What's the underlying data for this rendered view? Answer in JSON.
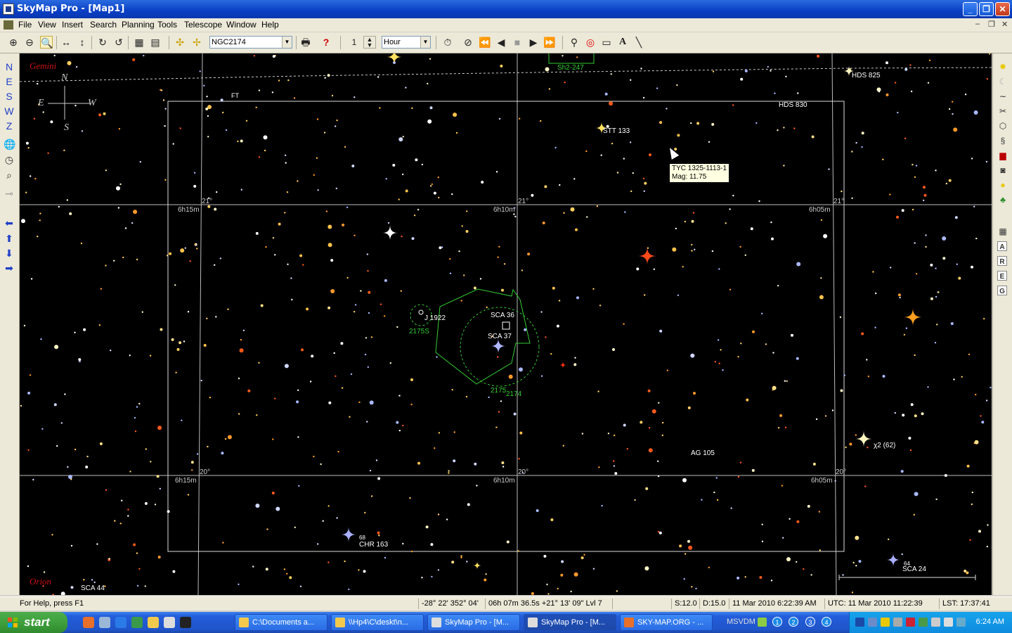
{
  "window": {
    "title": "SkyMap Pro - [Map1]",
    "buttons": {
      "minimize": "_",
      "restore": "❐",
      "close": "✕"
    }
  },
  "menu": {
    "items": [
      "File",
      "View",
      "Insert",
      "Search",
      "Planning",
      "Tools",
      "Telescope",
      "Window",
      "Help"
    ]
  },
  "toolbar": {
    "object_select": "NGC2174",
    "step_value": "1",
    "step_unit": "Hour"
  },
  "leftbar": {
    "direction_buttons": [
      "N",
      "E",
      "S",
      "W",
      "Z"
    ]
  },
  "rightbar": {
    "letter_buttons": [
      "A",
      "R",
      "E",
      "G"
    ]
  },
  "map": {
    "constellation_labels": [
      "Gemini",
      "Orion"
    ],
    "compass": {
      "n": "N",
      "e": "E",
      "s": "S",
      "w": "W"
    },
    "objects": {
      "sh2": "Sh2-247",
      "hds825": "HDS 825",
      "hds830": "HDS 830",
      "stt133": "STT 133",
      "ft": "FT",
      "j1922": "J 1922",
      "n2175s": "2175S",
      "sca36": "SCA 36",
      "sca37": "SCA 37",
      "n2175": "2175",
      "n2174": "2174",
      "ag105": "AG 105",
      "chi2": "χ2 (62)",
      "n68": "68",
      "chr163": "CHR 163",
      "sca44": "SCA 44",
      "n64": "64",
      "sca24": "SCA 24"
    },
    "grid_labels": {
      "ra_top_left": "6h15m",
      "dec_21_left": "21°",
      "ra_top_mid": "6h10m",
      "dec_21_mid": "21°",
      "ra_top_right": "6h05m",
      "dec_21_right": "21°",
      "ra_bot_left": "6h15m",
      "dec_20_left": "20°",
      "ra_bot_mid": "6h10m",
      "dec_20_mid": "20°",
      "ra_bot_right": "6h05m",
      "dec_20_right": "20°"
    },
    "tooltip": {
      "line1": "TYC 1325-1113-1",
      "line2": "Mag: 11.75"
    }
  },
  "status": {
    "help": "For Help, press F1",
    "altaz": "-28° 22'  352° 04'",
    "radec": "06h 07m 36.5s  +21° 13' 09\"  Lvl 7",
    "scale": "S:12.0",
    "depth": "D:15.0",
    "local": "11 Mar 2010 6:22:39 AM",
    "utc": "UTC: 11 Mar 2010 11:22:39",
    "lst": "LST: 17:37:41"
  },
  "taskbar": {
    "start": "start",
    "tasks": [
      {
        "label": "C:\\Documents a...",
        "color": "#f2c94c",
        "active": false
      },
      {
        "label": "\\\\Hp4\\C\\deskt\\n...",
        "color": "#f2c94c",
        "active": false
      },
      {
        "label": "SkyMap Pro - [M...",
        "color": "#ddd",
        "active": false
      },
      {
        "label": "SkyMap Pro - [M...",
        "color": "#ddd",
        "active": true
      },
      {
        "label": "SKY-MAP.ORG - ...",
        "color": "#e8702a",
        "active": false
      }
    ],
    "lang": "MSVDM",
    "desktops": [
      "1",
      "2",
      "3",
      "4"
    ],
    "clock": "6:24 AM"
  }
}
